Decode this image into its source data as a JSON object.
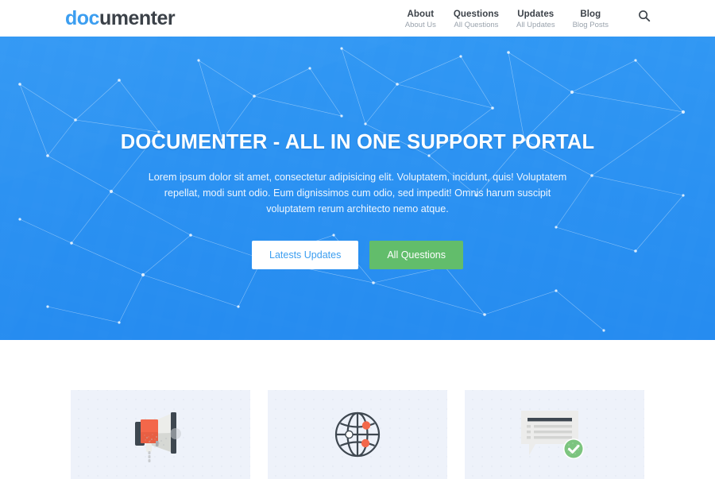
{
  "header": {
    "logo": {
      "part_blue": "doc",
      "part_dark": "umenter",
      "full": "documenter"
    },
    "nav": [
      {
        "label": "About",
        "sub": "About Us"
      },
      {
        "label": "Questions",
        "sub": "All Questions"
      },
      {
        "label": "Updates",
        "sub": "All Updates"
      },
      {
        "label": "Blog",
        "sub": "Blog Posts"
      }
    ],
    "search_icon": "search-icon"
  },
  "hero": {
    "title": "DOCUMENTER - ALL IN ONE SUPPORT PORTAL",
    "text": "Lorem ipsum dolor sit amet, consectetur adipisicing elit. Voluptatem, incidunt, quis! Voluptatem repellat, modi sunt odio. Eum dignissimos cum odio, sed impedit! Omnis harum suscipit voluptatem rerum architecto nemo atque.",
    "primary_button": "Latests Updates",
    "secondary_button": "All Questions"
  },
  "cards": [
    {
      "icon": "megaphone-icon"
    },
    {
      "icon": "globe-network-icon"
    },
    {
      "icon": "message-approved-icon"
    }
  ],
  "colors": {
    "brand_blue": "#3c9ef0",
    "hero_blue": "#2f96f3",
    "green": "#62bd6b",
    "dark_text": "#3b4148",
    "muted_text": "#9aa3ad",
    "card_bg": "#eef2fa",
    "orange": "#f3674a",
    "icon_dark": "#3e4750"
  }
}
